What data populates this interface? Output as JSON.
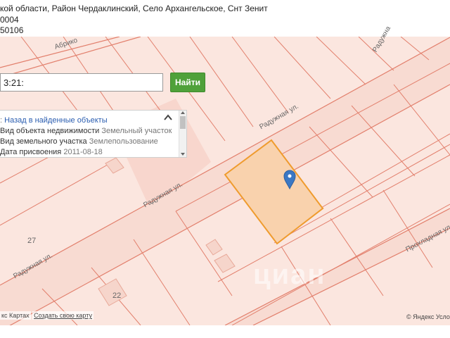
{
  "header": {
    "line1": "кой области, Район Чердаклинский, Село Архангельское, Снт Зенит",
    "line2": "0004",
    "line3": "50106"
  },
  "search": {
    "value": "3:21:",
    "button_label": "Найти"
  },
  "info_panel": {
    "back_link": "Назад в найденные объекты",
    "rows": [
      {
        "label": "Вид объекта недвижимости",
        "value": "Земельный участок"
      },
      {
        "label": "Вид земельного участка",
        "value": "Землепользование"
      },
      {
        "label": "Дата присвоения",
        "value": "2011-08-18"
      }
    ]
  },
  "map": {
    "street_labels": [
      "Абрико",
      "Радужная ул.",
      "Радужная ул.",
      "Радужная ул.",
      "Радужна",
      "Прохладная ул."
    ],
    "plot_numbers": [
      "27",
      "22"
    ],
    "colors": {
      "background": "#fbe6df",
      "plot_lines": "#e27f6c",
      "road": "#f7dcd3",
      "highlight_fill": "#f9d2ad",
      "highlight_stroke": "#ef9b2d",
      "marker": "#3b78c4"
    },
    "watermark": "циан"
  },
  "footer": {
    "left_text": "кс Картах",
    "create_map_link": "Создать свою карту",
    "right_text": "© Яндекс Услов"
  }
}
